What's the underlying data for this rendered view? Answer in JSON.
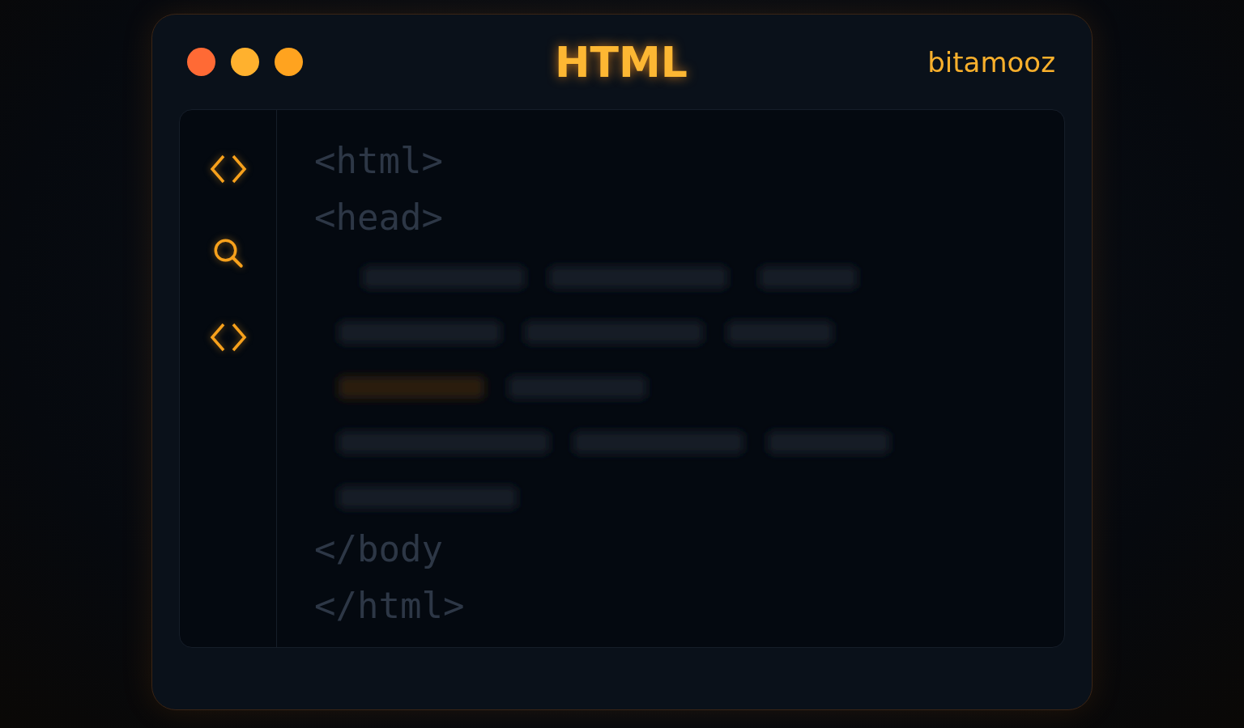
{
  "window": {
    "title": "HTML",
    "brand": "bitamooz"
  },
  "window_controls": [
    {
      "color": "#ff6a35"
    },
    {
      "color": "#ffb12e"
    },
    {
      "color": "#ffa31f"
    }
  ],
  "sidebar": {
    "items": [
      {
        "kind": "code"
      },
      {
        "kind": "search"
      },
      {
        "kind": "code"
      }
    ]
  },
  "editor": {
    "code_top": [
      "<html>",
      "<head>"
    ],
    "code_bottom": [
      "</body",
      "</html>"
    ]
  }
}
